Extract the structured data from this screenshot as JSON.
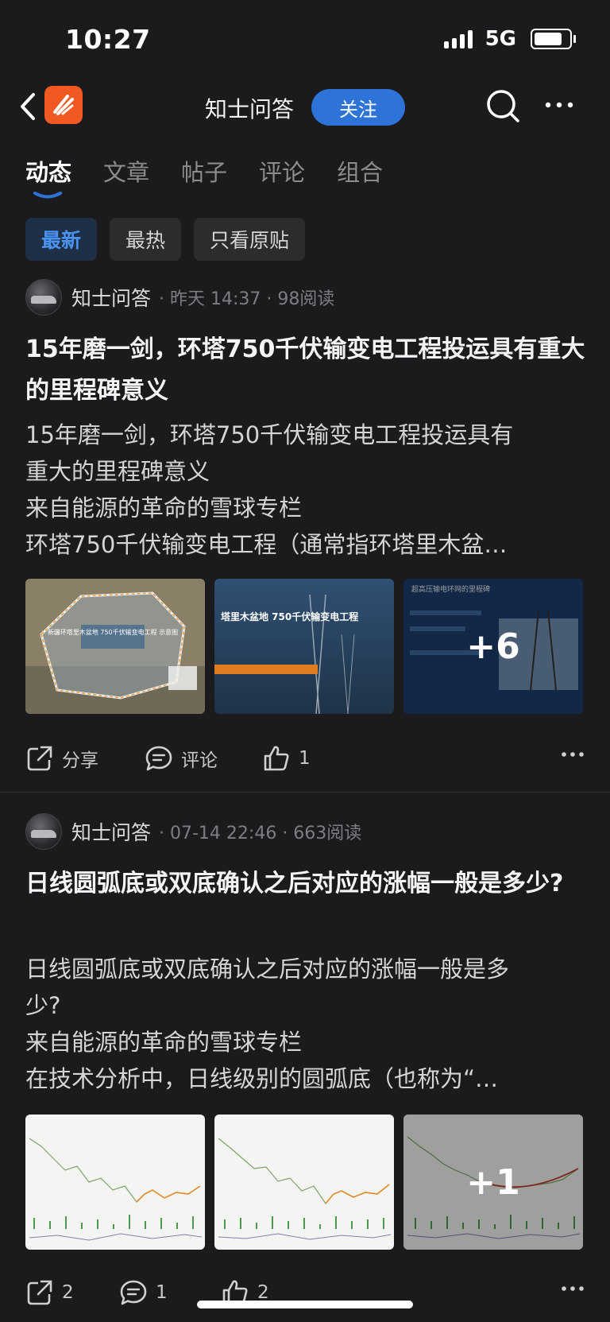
{
  "status": {
    "time": "10:27",
    "network": "5G"
  },
  "nav": {
    "title": "知士问答",
    "follow_label": "关注"
  },
  "tabs": [
    "动态",
    "文章",
    "帖子",
    "评论",
    "组合"
  ],
  "filters": [
    "最新",
    "最热",
    "只看原贴"
  ],
  "posts": [
    {
      "author": "知士问答",
      "meta": "· 昨天 14:37 · 98阅读",
      "title": "15年磨一剑，环塔750千伏输变电工程投运具有重大的里程碑意义",
      "body": [
        "15年磨一剑，环塔750千伏输变电工程投运具有",
        "重大的里程碑意义",
        "来自能源的革命的雪球专栏",
        "环塔750千伏输变电工程（通常指环塔里木盆…"
      ],
      "thumbs": [
        {
          "caption": "新疆环塔里木盆地 750千伏输变电工程 示意图"
        },
        {
          "caption": "塔里木盆地 750千伏输变电工程"
        },
        {
          "caption": "超高压输电环网的里程碑",
          "more": "+6"
        }
      ],
      "share_label": "分享",
      "comment_label": "评论",
      "like_count": "1"
    },
    {
      "author": "知士问答",
      "meta": "· 07-14 22:46 · 663阅读",
      "title": "日线圆弧底或双底确认之后对应的涨幅一般是多少?",
      "body": [
        "日线圆弧底或双底确认之后对应的涨幅一般是多",
        "少?",
        "来自能源的革命的雪球专栏",
        "在技术分析中，日线级别的圆弧底（也称为“…"
      ],
      "thumbs": [
        {
          "caption": ""
        },
        {
          "caption": ""
        },
        {
          "caption": "",
          "more": "+1"
        }
      ],
      "share_count": "2",
      "comment_count": "1",
      "like_count": "2"
    }
  ],
  "colors": {
    "accent": "#2d73d8",
    "logo": "#f05a22",
    "background": "#1b1b1d"
  }
}
